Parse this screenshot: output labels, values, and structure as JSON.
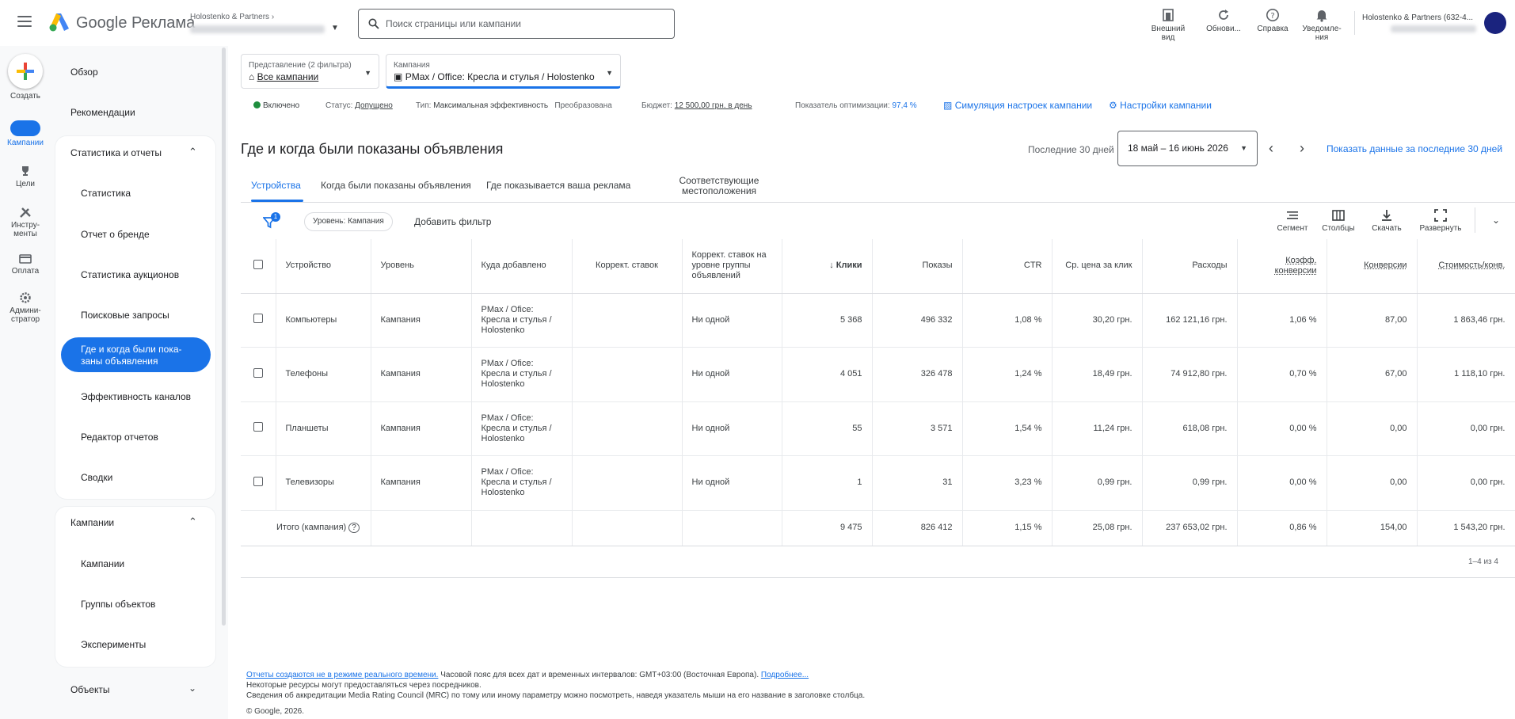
{
  "topbar": {
    "product": "Google Реклама",
    "account_name": "Holostenko & Partners",
    "search_placeholder": "Поиск страницы или кампании",
    "buttons": [
      {
        "label": "Внешний вид",
        "icon": "appearance-icon"
      },
      {
        "label": "Обнови...",
        "icon": "refresh-icon"
      },
      {
        "label": "Справка",
        "icon": "help-icon"
      },
      {
        "label": "Уведомле-ния",
        "icon": "bell-icon"
      }
    ],
    "user_label": "Holostenko & Partners (632-4..."
  },
  "rail": {
    "create": "Создать",
    "items": [
      {
        "label": "Кампании",
        "icon": "campaigns-icon"
      },
      {
        "label": "Цели",
        "icon": "trophy-icon"
      },
      {
        "label": "Инстру-менты",
        "icon": "tools-icon"
      },
      {
        "label": "Оплата",
        "icon": "billing-icon"
      },
      {
        "label": "Админи-стратор",
        "icon": "admin-gear-icon"
      }
    ]
  },
  "nav": {
    "overview": "Обзор",
    "recommendations": "Рекомендации",
    "stats_group": "Статистика и отчеты",
    "stats_items": [
      "Статистика",
      "Отчет о бренде",
      "Статистика аукционов",
      "Поисковые запросы",
      "Где и когда были пока-заны объявления",
      "Эффективность каналов",
      "Редактор отчетов",
      "Сводки"
    ],
    "campaigns_group": "Кампании",
    "campaigns_items": [
      "Кампании",
      "Группы объектов",
      "Эксперименты"
    ],
    "objects": "Объекты"
  },
  "filters": {
    "view_caption": "Представление (2 фильтра)",
    "view_value": "Все кампании",
    "campaign_caption": "Кампания",
    "campaign_value": "PMax / Office: Кресла и стулья / Holostenko"
  },
  "status": {
    "enabled": "Включено",
    "status_label": "Статус:",
    "status_value": "Допущено",
    "type_label": "Тип:",
    "type_value": "Максимальная эффективность",
    "converted": "Преобразована",
    "budget_label": "Бюджет:",
    "budget_value": "12 500,00 грн. в день",
    "opt_label": "Показатель оптимизации:",
    "opt_value": "97,4 %",
    "simulation": "Симуляция настроек кампании",
    "settings": "Настройки кампании"
  },
  "page": {
    "title": "Где и когда были показаны объявления",
    "period_label": "Последние 30 дней",
    "date_range": "18 май – 16 июнь 2026",
    "show_last": "Показать данные за последние 30 дней"
  },
  "tabs": [
    "Устройства",
    "Когда были показаны объявления",
    "Где показывается ваша реклама",
    "Соответствующие местоположения"
  ],
  "toolbar": {
    "filter_count": "1",
    "level_chip": "Уровень: Кампания",
    "add_filter": "Добавить фильтр",
    "segment": "Сегмент",
    "columns": "Столбцы",
    "download": "Скачать",
    "expand": "Развернуть"
  },
  "table": {
    "headers": {
      "device": "Устройство",
      "level": "Уровень",
      "added_to": "Куда добавлено",
      "bid_adj": "Коррект. ставок",
      "group_bid_adj": "Коррект. ставок на уровне группы объявлений",
      "clicks": "Клики",
      "impressions": "Показы",
      "ctr": "CTR",
      "avg_cpc": "Ср. цена за клик",
      "cost": "Расходы",
      "conv_rate": "Коэфф. конверсии",
      "conversions": "Конверсии",
      "cost_per_conv": "Стоимость/конв."
    },
    "rows": [
      {
        "device": "Компьютеры",
        "level": "Кампания",
        "added_to": "PMax / Ofice: Кресла и стулья / Holostenko",
        "bid_adj": "",
        "group_bid_adj": "Ни одной",
        "clicks": "5 368",
        "impressions": "496 332",
        "ctr": "1,08 %",
        "avg_cpc": "30,20 грн.",
        "cost": "162 121,16 грн.",
        "conv_rate": "1,06 %",
        "conversions": "87,00",
        "cost_per_conv": "1 863,46 грн."
      },
      {
        "device": "Телефоны",
        "level": "Кампания",
        "added_to": "PMax / Ofice: Кресла и стулья / Holostenko",
        "bid_adj": "",
        "group_bid_adj": "Ни одной",
        "clicks": "4 051",
        "impressions": "326 478",
        "ctr": "1,24 %",
        "avg_cpc": "18,49 грн.",
        "cost": "74 912,80 грн.",
        "conv_rate": "0,70 %",
        "conversions": "67,00",
        "cost_per_conv": "1 118,10 грн."
      },
      {
        "device": "Планшеты",
        "level": "Кампания",
        "added_to": "PMax / Ofice: Кресла и стулья / Holostenko",
        "bid_adj": "",
        "group_bid_adj": "Ни одной",
        "clicks": "55",
        "impressions": "3 571",
        "ctr": "1,54 %",
        "avg_cpc": "11,24 грн.",
        "cost": "618,08 грн.",
        "conv_rate": "0,00 %",
        "conversions": "0,00",
        "cost_per_conv": "0,00 грн."
      },
      {
        "device": "Телевизоры",
        "level": "Кампания",
        "added_to": "PMax / Ofice: Кресла и стулья / Holostenko",
        "bid_adj": "",
        "group_bid_adj": "Ни одной",
        "clicks": "1",
        "impressions": "31",
        "ctr": "3,23 %",
        "avg_cpc": "0,99 грн.",
        "cost": "0,99 грн.",
        "conv_rate": "0,00 %",
        "conversions": "0,00",
        "cost_per_conv": "0,00 грн."
      }
    ],
    "total": {
      "label": "Итого (кампания)",
      "clicks": "9 475",
      "impressions": "826 412",
      "ctr": "1,15 %",
      "avg_cpc": "25,08 грн.",
      "cost": "237 653,02 грн.",
      "conv_rate": "0,86 %",
      "conversions": "154,00",
      "cost_per_conv": "1 543,20 грн."
    },
    "pagination": "1–4 из 4"
  },
  "footer": {
    "not_realtime": "Отчеты создаются не в режиме реального времени.",
    "timezone": "Часовой пояс для всех дат и временных интервалов: GMT+03:00 (Восточная Европа).",
    "more": "Подробнее...",
    "line2": "Некоторые ресурсы могут предоставляться через посредников.",
    "line3": "Сведения об аккредитации Media Rating Council (MRC) по тому или иному параметру можно посмотреть, наведя указатель мыши на его название в заголовке столбца.",
    "copyright": "© Google, 2026."
  },
  "colors": {
    "accent": "#1a73e8",
    "enabled": "#1e8e3e"
  }
}
